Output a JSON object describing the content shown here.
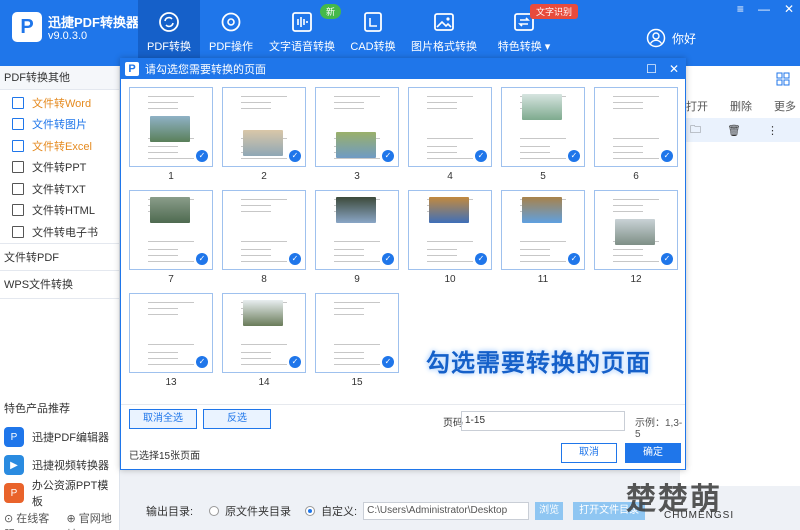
{
  "app": {
    "name": "迅捷PDF转换器",
    "version": "v9.0.3.0",
    "logo_letter": "P"
  },
  "nav": [
    {
      "label": "PDF转换",
      "icon": "refresh-icon",
      "active": true
    },
    {
      "label": "PDF操作",
      "icon": "gear-icon"
    },
    {
      "label": "文字语音转换",
      "icon": "audio-wave-icon"
    },
    {
      "label": "CAD转换",
      "icon": "cad-icon"
    },
    {
      "label": "图片格式转换",
      "icon": "image-icon"
    },
    {
      "label": "特色转换",
      "icon": "special-convert-icon"
    }
  ],
  "badges": {
    "new": "新",
    "ocr": "文字识别"
  },
  "user": {
    "label": "你好"
  },
  "window": {
    "menu": "≡",
    "minimize": "—",
    "close": "✕"
  },
  "sidebar": {
    "category1": "PDF转换其他",
    "items": [
      {
        "label": "文件转Word"
      },
      {
        "label": "文件转图片"
      },
      {
        "label": "文件转Excel"
      },
      {
        "label": "文件转PPT"
      },
      {
        "label": "文件转TXT"
      },
      {
        "label": "文件转HTML"
      },
      {
        "label": "文件转电子书"
      }
    ],
    "category2": "文件转PDF",
    "category3": "WPS文件转换",
    "promo_title": "特色产品推荐",
    "promos": [
      {
        "label": "迅捷PDF编辑器",
        "color": "#1f76ea",
        "icon_text": "P"
      },
      {
        "label": "迅捷视频转换器",
        "color": "#2a8be0",
        "icon_text": "▶"
      },
      {
        "label": "办公资源PPT模板",
        "color": "#e9632b",
        "icon_text": "P"
      }
    ],
    "footer": {
      "service": "在线客服",
      "website": "官网地址"
    }
  },
  "right_panel": {
    "open": "打开",
    "delete": "删除",
    "more": "更多"
  },
  "output": {
    "label": "输出目录:",
    "option_source": "原文件夹目录",
    "option_custom": "自定义:",
    "path": "C:\\Users\\Administrator\\Desktop",
    "browse": "浏览",
    "open_folder": "打开文件目录"
  },
  "watermark": {
    "main": "楚楚萌",
    "sub": "CHUMENGSI"
  },
  "dialog": {
    "title": "请勾选您需要转换的页面",
    "pages": [
      "1",
      "2",
      "3",
      "4",
      "5",
      "6",
      "7",
      "8",
      "9",
      "10",
      "11",
      "12",
      "13",
      "14",
      "15"
    ],
    "promo_text": "勾选需要转换的页面",
    "btn_deselect_all": "取消全选",
    "btn_invert": "反选",
    "page_range_label": "页码",
    "page_range_value": "1-15",
    "example": "示例：1,3-5",
    "selected_status": "已选择15张页面",
    "btn_cancel": "取消",
    "btn_ok": "确定"
  },
  "colors": {
    "brand": "#1f76ea",
    "highlight": "#e58a1f",
    "promo_text": "#1560c9"
  }
}
